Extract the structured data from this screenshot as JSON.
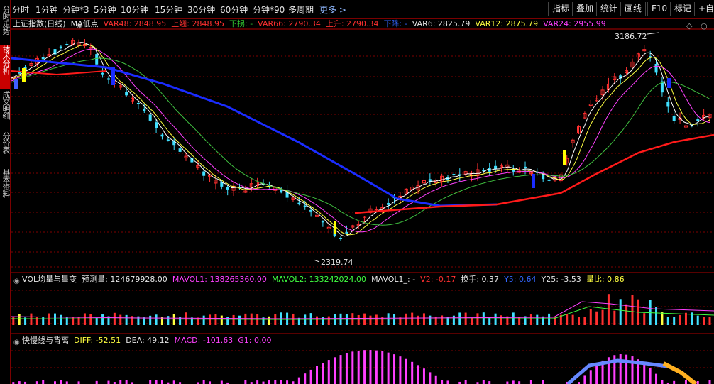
{
  "period_tabs": [
    "分时",
    "1分钟",
    "分钟*3",
    "5分钟",
    "10分钟",
    "15分钟",
    "30分钟",
    "60分钟",
    "分钟*90",
    "多周期",
    "更多 >"
  ],
  "toolbar_buttons": [
    "指标",
    "叠加",
    "统计",
    "画线",
    "F10",
    "标记",
    "+自选"
  ],
  "side_tabs": [
    {
      "label": "分时走势",
      "active": false
    },
    {
      "label": "技术分析",
      "active": true
    },
    {
      "label": "成交明细",
      "active": false
    },
    {
      "label": "分价表",
      "active": false
    },
    {
      "label": "基本资料",
      "active": false
    }
  ],
  "main_panel": {
    "legend": [
      {
        "text": "上证指数(日线)",
        "color": "#e6e6e6"
      },
      {
        "text": "MA低点",
        "color": "#e6e6e6"
      },
      {
        "text": "VAR48: 2848.95",
        "color": "#ff3030"
      },
      {
        "text": "上翘: 2848.95",
        "color": "#ff3030"
      },
      {
        "text": "下拐: -",
        "color": "#30c030"
      },
      {
        "text": "VAR66: 2790.34",
        "color": "#ff3030"
      },
      {
        "text": "上升: 2790.34",
        "color": "#ff3030"
      },
      {
        "text": "下降: -",
        "color": "#3366ff"
      },
      {
        "text": "VAR6: 2825.79",
        "color": "#e6e6e6"
      },
      {
        "text": "VAR12: 2875.79",
        "color": "#ffff40"
      },
      {
        "text": "VAR24: 2955.99",
        "color": "#ff40ff"
      }
    ],
    "price_high_label": "3186.72",
    "price_low_label": "2319.74"
  },
  "vol_panel": {
    "legend": [
      {
        "text": "VOL均量与量变",
        "color": "#e6e6e6"
      },
      {
        "text": "预测量: 124679928.00",
        "color": "#e6e6e6"
      },
      {
        "text": "MAVOL1: 138265360.00",
        "color": "#ff40ff"
      },
      {
        "text": "MAVOL2: 133242024.00",
        "color": "#40ff40"
      },
      {
        "text": "MAVOL1_: -",
        "color": "#e6e6e6"
      },
      {
        "text": "V2: -0.17",
        "color": "#ff3030"
      },
      {
        "text": "换手: 0.37",
        "color": "#e6e6e6"
      },
      {
        "text": "Y5: 0.64",
        "color": "#3366ff"
      },
      {
        "text": "Y25: -3.53",
        "color": "#e6e6e6"
      },
      {
        "text": "量比: 0.86",
        "color": "#ffff40"
      }
    ]
  },
  "macd_panel": {
    "legend": [
      {
        "text": "快慢线与背离",
        "color": "#e6e6e6"
      },
      {
        "text": "DIFF: -52.51",
        "color": "#ffff40"
      },
      {
        "text": "DEA: 49.12",
        "color": "#e6e6e6"
      },
      {
        "text": "MACD: -101.63",
        "color": "#ff40ff"
      },
      {
        "text": "G1: 0.00",
        "color": "#ff40ff"
      }
    ]
  },
  "colors": {
    "up": "#ff3030",
    "down": "#40e0ff",
    "bg": "#000000",
    "grid": "#800000",
    "ma_blue": "#1a2cff",
    "ma_red": "#ff1a1a"
  }
}
